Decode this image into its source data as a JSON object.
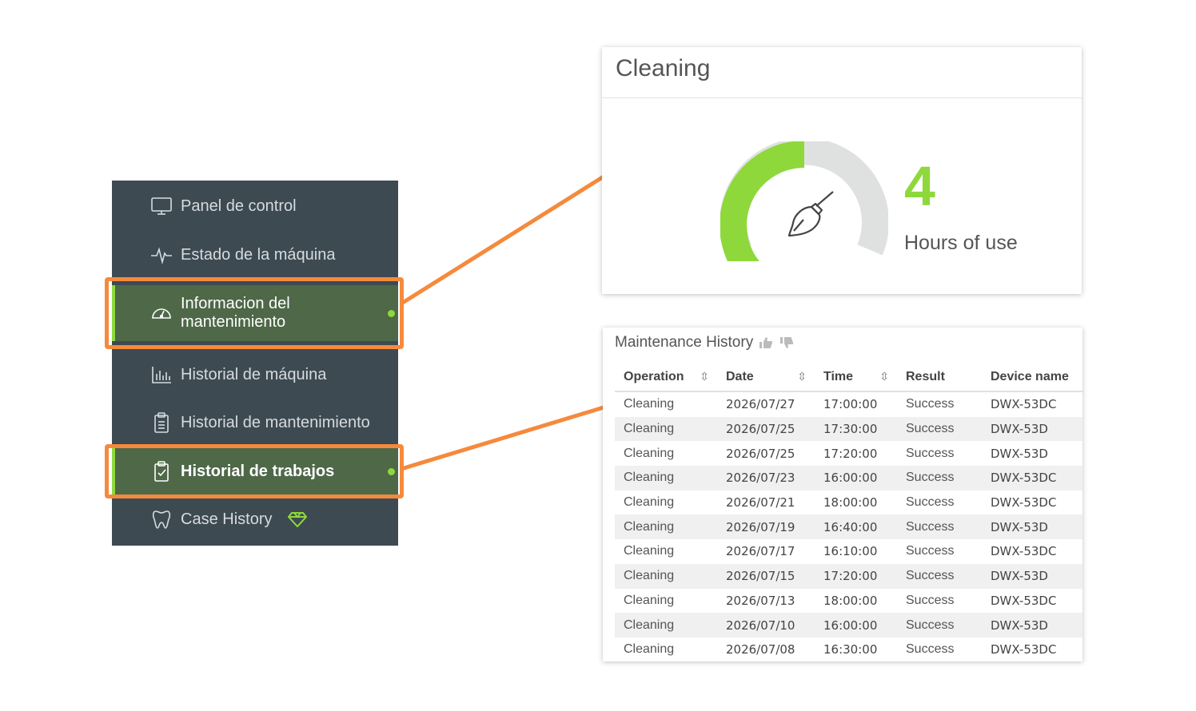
{
  "sidebar": {
    "items": [
      {
        "label": "Panel de control",
        "icon": "monitor-icon",
        "active": false
      },
      {
        "label": "Estado de la máquina",
        "icon": "pulse-icon",
        "active": false
      },
      {
        "label_line1": "Informacion del",
        "label_line2": "mantenimiento",
        "icon": "gauge-icon",
        "active": true
      },
      {
        "label": "Historial de máquina",
        "icon": "bar-chart-icon",
        "active": false
      },
      {
        "label": "Historial de mantenimiento",
        "icon": "clipboard-list-icon",
        "active": false
      },
      {
        "label": "Historial de trabajos",
        "icon": "clipboard-check-icon",
        "active": true
      },
      {
        "label": "Case History",
        "icon": "tooth-icon",
        "badge_icon": "gem-icon",
        "active": false
      }
    ]
  },
  "cleaning_card": {
    "title": "Cleaning",
    "value": "4",
    "unit": "Hours of use",
    "gauge_fraction": 0.5,
    "icon": "broom-icon"
  },
  "maintenance_history": {
    "title": "Maintenance History",
    "icons": [
      "thumbs-up-icon",
      "thumbs-down-icon"
    ],
    "columns": [
      "Operation",
      "Date",
      "Time",
      "Result",
      "Device name"
    ],
    "rows": [
      [
        "Cleaning",
        "2026/07/27",
        "17:00:00",
        "Success",
        "DWX-53DC"
      ],
      [
        "Cleaning",
        "2026/07/25",
        "17:30:00",
        "Success",
        "DWX-53D"
      ],
      [
        "Cleaning",
        "2026/07/25",
        "17:20:00",
        "Success",
        "DWX-53D"
      ],
      [
        "Cleaning",
        "2026/07/23",
        "16:00:00",
        "Success",
        "DWX-53DC"
      ],
      [
        "Cleaning",
        "2026/07/21",
        "18:00:00",
        "Success",
        "DWX-53DC"
      ],
      [
        "Cleaning",
        "2026/07/19",
        "16:40:00",
        "Success",
        "DWX-53D"
      ],
      [
        "Cleaning",
        "2026/07/17",
        "16:10:00",
        "Success",
        "DWX-53DC"
      ],
      [
        "Cleaning",
        "2026/07/15",
        "17:20:00",
        "Success",
        "DWX-53D"
      ],
      [
        "Cleaning",
        "2026/07/13",
        "18:00:00",
        "Success",
        "DWX-53DC"
      ],
      [
        "Cleaning",
        "2026/07/10",
        "16:00:00",
        "Success",
        "DWX-53D"
      ],
      [
        "Cleaning",
        "2026/07/08",
        "16:30:00",
        "Success",
        "DWX-53DC"
      ]
    ]
  },
  "colors": {
    "sidebar_bg": "#3d4a52",
    "active_bg": "#4e6848",
    "accent_green": "#8ed83c",
    "highlight_orange": "#f58a3c"
  }
}
